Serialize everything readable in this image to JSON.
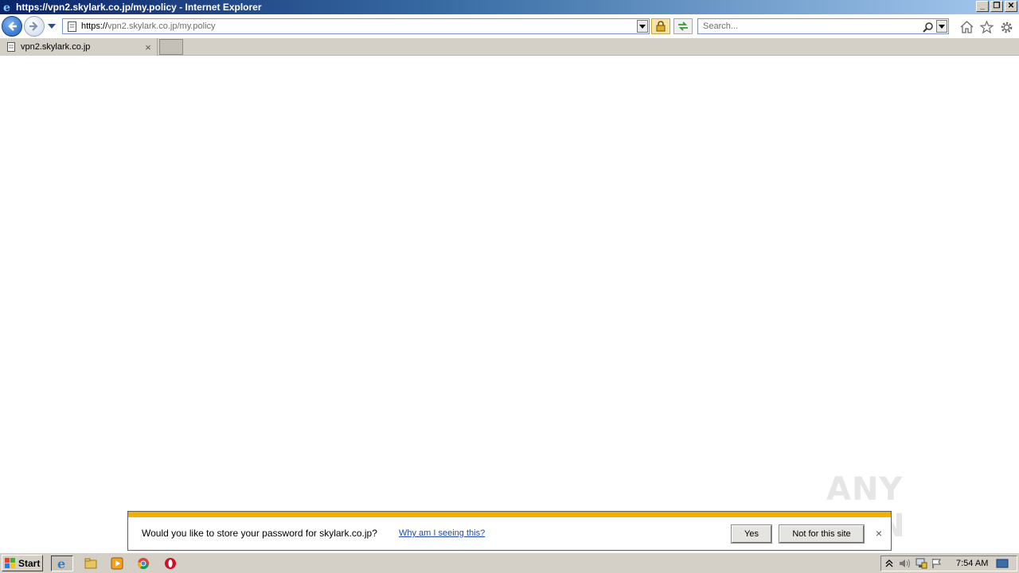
{
  "window": {
    "title": "https://vpn2.skylark.co.jp/my.policy - Internet Explorer",
    "controls": {
      "minimize": "_",
      "restore": "❐",
      "close": "✕"
    }
  },
  "navbar": {
    "address": {
      "scheme": "https://",
      "host": "vpn2.skylark.co.jp",
      "path": "/my.policy"
    },
    "search": {
      "placeholder": "Search..."
    },
    "icons": [
      "back-icon",
      "forward-icon",
      "recent-pages-icon",
      "page-icon",
      "lock-icon",
      "refresh-icon",
      "search-icon",
      "home-icon",
      "favorites-star-icon",
      "gear-icon"
    ]
  },
  "tabs": [
    {
      "label": "vpn2.skylark.co.jp",
      "active": true,
      "close": "×"
    }
  ],
  "notification": {
    "message": "Would you like to store your password for skylark.co.jp?",
    "why_link": "Why am I seeing this?",
    "yes_label": "Yes",
    "not_for_site_label": "Not for this site",
    "close": "×",
    "accent_color": "#f0b000"
  },
  "watermark": {
    "text": "ANY RUN"
  },
  "taskbar": {
    "start_label": "Start",
    "pinned": [
      "internet-explorer-icon",
      "windows-explorer-icon",
      "media-player-icon",
      "chrome-icon",
      "opera-icon"
    ],
    "tray_icons": [
      "show-hidden-icon",
      "volume-icon",
      "network-icon",
      "action-center-flag-icon"
    ],
    "clock": "7:54 AM"
  }
}
